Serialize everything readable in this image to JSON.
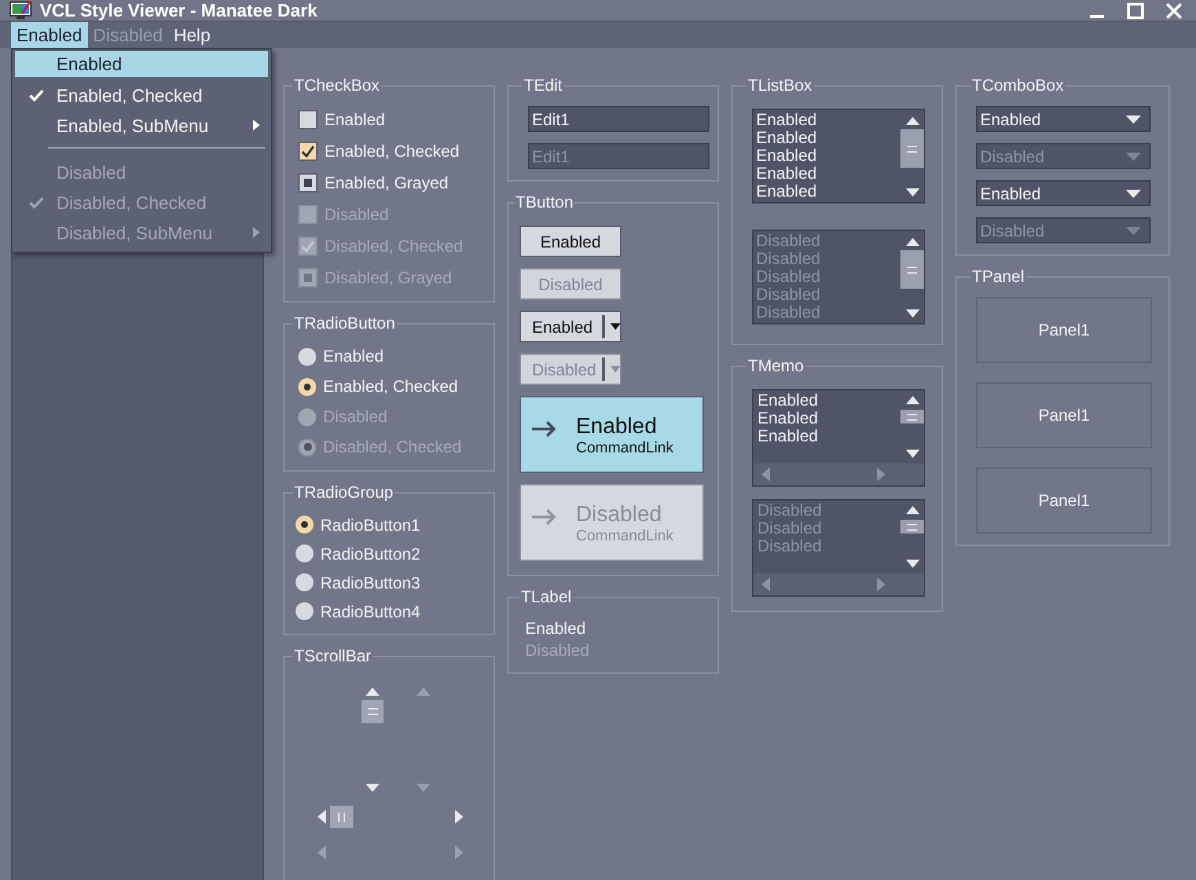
{
  "window": {
    "title": "VCL Style Viewer - Manatee Dark"
  },
  "menu_bar": [
    {
      "label": "Enabled",
      "selected": true,
      "disabled": false
    },
    {
      "label": "Disabled",
      "selected": false,
      "disabled": true
    },
    {
      "label": "Help",
      "selected": false,
      "disabled": false
    }
  ],
  "dropdown_menu": [
    {
      "kind": "item",
      "label": "Enabled",
      "selected": true,
      "disabled": false,
      "checked": false,
      "submenu": false
    },
    {
      "kind": "item",
      "label": "Enabled, Checked",
      "selected": false,
      "disabled": false,
      "checked": true,
      "submenu": false
    },
    {
      "kind": "item",
      "label": "Enabled, SubMenu",
      "selected": false,
      "disabled": false,
      "checked": false,
      "submenu": true
    },
    {
      "kind": "separator"
    },
    {
      "kind": "item",
      "label": "Disabled",
      "selected": false,
      "disabled": true,
      "checked": false,
      "submenu": false
    },
    {
      "kind": "item",
      "label": "Disabled, Checked",
      "selected": false,
      "disabled": true,
      "checked": true,
      "submenu": false
    },
    {
      "kind": "item",
      "label": "Disabled, SubMenu",
      "selected": false,
      "disabled": true,
      "checked": false,
      "submenu": true
    }
  ],
  "checkbox_group": {
    "title": "TCheckBox",
    "items": [
      {
        "label": "Enabled",
        "checked": false,
        "grayed": false,
        "disabled": false
      },
      {
        "label": "Enabled, Checked",
        "checked": true,
        "grayed": false,
        "disabled": false
      },
      {
        "label": "Enabled, Grayed",
        "checked": false,
        "grayed": true,
        "disabled": false
      },
      {
        "label": "Disabled",
        "checked": false,
        "grayed": false,
        "disabled": true
      },
      {
        "label": "Disabled, Checked",
        "checked": true,
        "grayed": false,
        "disabled": true
      },
      {
        "label": "Disabled, Grayed",
        "checked": false,
        "grayed": true,
        "disabled": true
      }
    ]
  },
  "radio_button_group": {
    "title": "TRadioButton",
    "items": [
      {
        "label": "Enabled",
        "selected": false,
        "disabled": false
      },
      {
        "label": "Enabled, Checked",
        "selected": true,
        "disabled": false
      },
      {
        "label": "Disabled",
        "selected": false,
        "disabled": true
      },
      {
        "label": "Disabled, Checked",
        "selected": true,
        "disabled": true
      }
    ]
  },
  "radio_group": {
    "title": "TRadioGroup",
    "items": [
      {
        "label": "RadioButton1",
        "selected": true
      },
      {
        "label": "RadioButton2",
        "selected": false
      },
      {
        "label": "RadioButton3",
        "selected": false
      },
      {
        "label": "RadioButton4",
        "selected": false
      }
    ]
  },
  "scroll_bar_group": {
    "title": "TScrollBar",
    "vertical": [
      {
        "disabled": false
      },
      {
        "disabled": true
      }
    ],
    "horizontal": [
      {
        "disabled": false
      },
      {
        "disabled": true
      }
    ]
  },
  "edit_group": {
    "title": "TEdit",
    "fields": [
      {
        "value": "Edit1",
        "disabled": false
      },
      {
        "value": "Edit1",
        "disabled": true
      }
    ]
  },
  "button_group": {
    "title": "TButton",
    "buttons": [
      {
        "kind": "push",
        "label": "Enabled",
        "disabled": false
      },
      {
        "kind": "push",
        "label": "Disabled",
        "disabled": true
      },
      {
        "kind": "split",
        "label": "Enabled",
        "disabled": false
      },
      {
        "kind": "split",
        "label": "Disabled",
        "disabled": true
      },
      {
        "kind": "command_link",
        "label": "Enabled",
        "note": "CommandLink",
        "disabled": false
      },
      {
        "kind": "command_link",
        "label": "Disabled",
        "note": "CommandLink",
        "disabled": true
      }
    ]
  },
  "label_group": {
    "title": "TLabel",
    "labels": [
      {
        "text": "Enabled",
        "disabled": false
      },
      {
        "text": "Disabled",
        "disabled": true
      }
    ]
  },
  "listbox_group": {
    "title": "TListBox",
    "lists": [
      {
        "items": [
          "Enabled",
          "Enabled",
          "Enabled",
          "Enabled",
          "Enabled"
        ],
        "disabled": false
      },
      {
        "items": [
          "Disabled",
          "Disabled",
          "Disabled",
          "Disabled",
          "Disabled"
        ],
        "disabled": true
      }
    ]
  },
  "memo_group": {
    "title": "TMemo",
    "memos": [
      {
        "lines": [
          "Enabled",
          "Enabled",
          "Enabled"
        ],
        "disabled": false
      },
      {
        "lines": [
          "Disabled",
          "Disabled",
          "Disabled"
        ],
        "disabled": true
      }
    ]
  },
  "combobox_group": {
    "title": "TComboBox",
    "combos": [
      {
        "value": "Enabled",
        "disabled": false
      },
      {
        "value": "Disabled",
        "disabled": true
      },
      {
        "value": "Enabled",
        "disabled": false
      },
      {
        "value": "Disabled",
        "disabled": true
      }
    ]
  },
  "panel_group": {
    "title": "TPanel",
    "panels": [
      {
        "caption": "Panel1"
      },
      {
        "caption": "Panel1"
      },
      {
        "caption": "Panel1"
      }
    ]
  }
}
